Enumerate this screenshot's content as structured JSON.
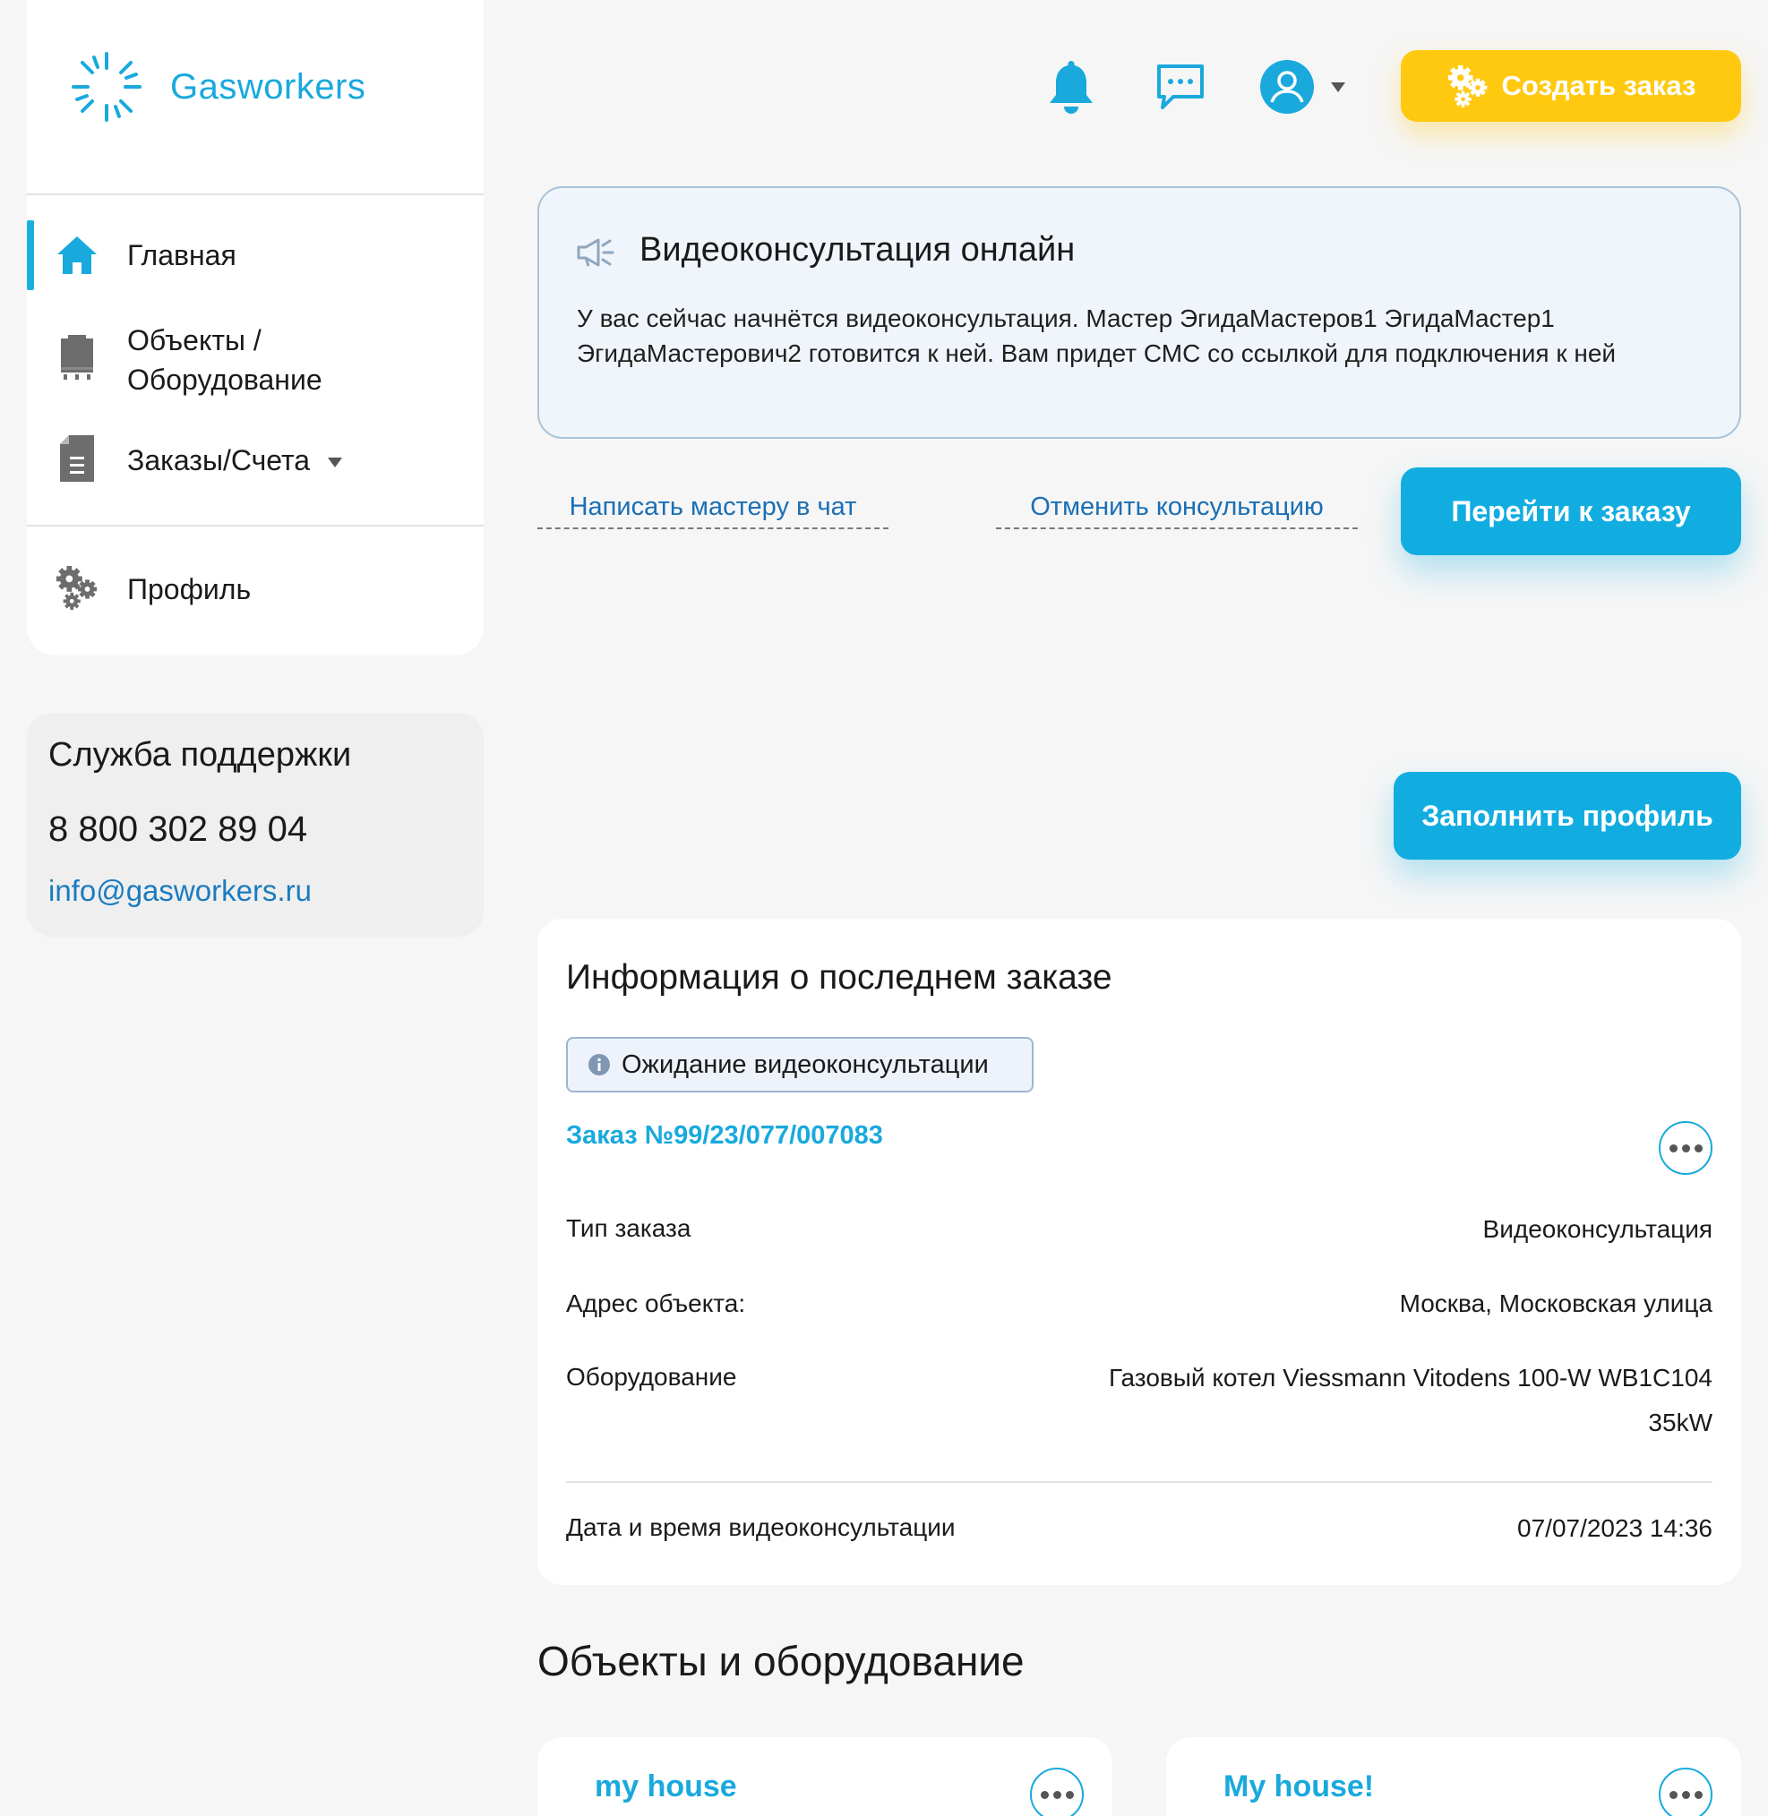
{
  "brand": {
    "name": "Gasworkers",
    "accent": "#19a9dd",
    "yellow": "#ffc910"
  },
  "sidebar": {
    "items": [
      {
        "label": "Главная",
        "icon": "home-icon"
      },
      {
        "label": "Объекты /",
        "label2": "Оборудование",
        "icon": "boiler-icon"
      },
      {
        "label": "Заказы/Счета",
        "icon": "document-icon"
      },
      {
        "label": "Профиль",
        "icon": "gears-icon"
      }
    ]
  },
  "support": {
    "title": "Служба поддержки",
    "phone": "8 800 302 89 04",
    "email": "info@gasworkers.ru"
  },
  "header": {
    "create_order": "Создать заказ"
  },
  "notice": {
    "title": "Видеоконсультация онлайн",
    "text": "У вас сейчас начнётся видеоконсультация. Мастер ЭгидаМастеров1 ЭгидаМастер1 ЭгидаМастерович2 готовится к ней. Вам придет СМС со ссылкой для подключения к ней",
    "chat_link": "Написать мастеру в чат",
    "cancel_link": "Отменить консультацию",
    "go_to_order": "Перейти к заказу"
  },
  "fill_profile": "Заполнить профиль",
  "last_order": {
    "title": "Информация о последнем заказе",
    "status": "Ожидание видеоконсультации",
    "order_number": "Заказ №99/23/077/007083",
    "rows": [
      {
        "label": "Тип заказа",
        "value": "Видеоконсультация"
      },
      {
        "label": "Адрес объекта:",
        "value": "Москва, Московская улица"
      },
      {
        "label": "Оборудование",
        "value": "Газовый котел Viessmann Vitodens 100-W WB1C104",
        "value2": "35kW"
      }
    ],
    "datetime_label": "Дата и время видеоконсультации",
    "datetime_value": "07/07/2023 14:36"
  },
  "objects": {
    "title": "Объекты и оборудование",
    "items": [
      {
        "name": "my house"
      },
      {
        "name": "My house!"
      }
    ]
  }
}
